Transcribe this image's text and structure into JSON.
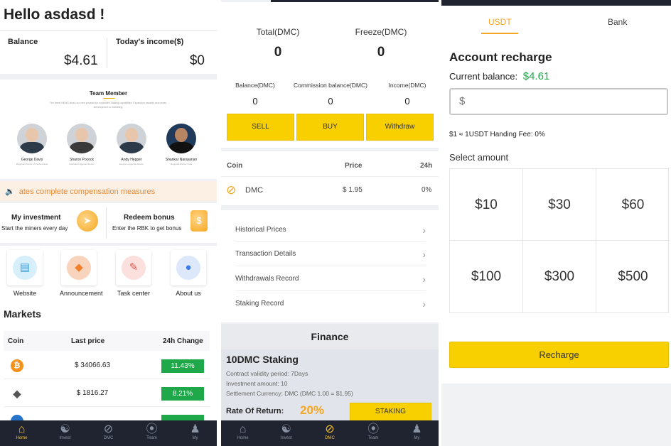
{
  "home": {
    "greeting": "Hello asdasd !",
    "balance_label": "Balance",
    "balance_value": "$4.61",
    "income_label": "Today's income($)",
    "income_value": "$0",
    "team_title": "Team Member",
    "team_desc": "The latest NEWS about our new projects for expanded Staking capabilities. Expansion towards new areas. Development in marketing.",
    "members": [
      {
        "name": "George Davis",
        "role": "Regional director of the Americas"
      },
      {
        "name": "Sharon Pocock",
        "role": "Australian regional director"
      },
      {
        "name": "Andy Hepper",
        "role": "Europe's regional director"
      },
      {
        "name": "Shankar Narayanan",
        "role": "Regional director India"
      }
    ],
    "notice": "ates complete compensation measures",
    "my_investment_title": "My investment",
    "my_investment_sub": "Start the miners every day",
    "redeem_title": "Redeem bonus",
    "redeem_sub": "Enter the RBK to get bonus",
    "quick": [
      {
        "label": "Website",
        "icon": "book-icon"
      },
      {
        "label": "Announcement",
        "icon": "announcement-icon"
      },
      {
        "label": "Task center",
        "icon": "pen-icon"
      },
      {
        "label": "About us",
        "icon": "info-icon"
      }
    ],
    "markets_title": "Markets",
    "markets_head": {
      "coin": "Coin",
      "price": "Last price",
      "change": "24h Change"
    },
    "markets": [
      {
        "coin": "bitcoin-icon",
        "price": "$ 34066.63",
        "change": "11.43%"
      },
      {
        "coin": "ethereum-icon",
        "price": "$ 1816.27",
        "change": "8.21%"
      }
    ]
  },
  "tabbar1": [
    "Home",
    "Invest",
    "DMC",
    "Team",
    "My"
  ],
  "dmc": {
    "total_label": "Total(DMC)",
    "total_value": "0",
    "freeze_label": "Freeze(DMC)",
    "freeze_value": "0",
    "balance_label": "Balance(DMC)",
    "balance_value": "0",
    "commission_label": "Commission balance(DMC)",
    "commission_value": "0",
    "income_label": "Income(DMC)",
    "income_value": "0",
    "sell": "SELL",
    "buy": "BUY",
    "withdraw": "Withdraw",
    "coin_head": {
      "coin": "Coin",
      "price": "Price",
      "h24": "24h"
    },
    "coin_row": {
      "name": "DMC",
      "price": "$ 1.95",
      "change": "0%"
    },
    "links": [
      "Historical Prices",
      "Transaction Details",
      "Withdrawals Record",
      "Staking Record"
    ],
    "finance_title": "Finance",
    "staking_title": "10DMC Staking",
    "staking_lines": [
      "Contract validity period: 7Days",
      "Investment amount: 10",
      "Settlement Currency: DMC (DMC 1.00 = $1.95)"
    ],
    "ror_label": "Rate Of Return:",
    "ror_value": "20%",
    "staking_btn": "STAKING"
  },
  "recharge": {
    "tab_usdt": "USDT",
    "tab_bank": "Bank",
    "title": "Account recharge",
    "current_label": "Current balance:",
    "current_value": "$4.61",
    "input_prefix": "$",
    "rate": "$1 ≈ 1USDT  Handing Fee: 0%",
    "select_label": "Select amount",
    "amounts": [
      "$10",
      "$30",
      "$60",
      "$100",
      "$300",
      "$500"
    ],
    "button": "Recharge"
  },
  "colors": {
    "accent": "#f8d000",
    "green": "#1fa84a",
    "orange": "#f5a623"
  }
}
